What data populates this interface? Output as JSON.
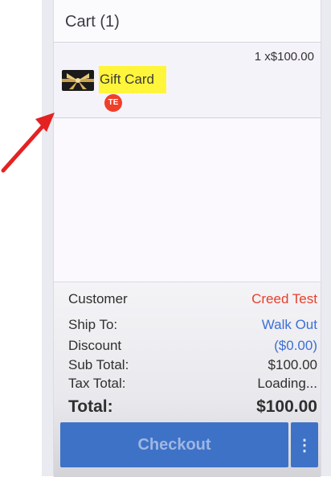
{
  "cart": {
    "title": "Cart (1)"
  },
  "item": {
    "quantity_price": "1 x$100.00",
    "name": "Gift Card",
    "badge": "TE",
    "thumbnail": "gift-card-thumbnail"
  },
  "summary": {
    "customer_label": "Customer",
    "customer_value": "Creed Test",
    "ship_label": "Ship To:",
    "ship_value": "Walk Out",
    "discount_label": "Discount",
    "discount_value": "($0.00)",
    "subtotal_label": "Sub Total:",
    "subtotal_value": "$100.00",
    "tax_label": "Tax Total:",
    "tax_value": "Loading...",
    "total_label": "Total:",
    "total_value": "$100.00"
  },
  "actions": {
    "checkout_label": "Checkout",
    "more_icon": "⋮"
  },
  "colors": {
    "accent": "#3e72c6",
    "customer_text": "#e6402c",
    "link_text": "#3d6fd6",
    "highlight": "#fff53a",
    "arrow": "#e32222"
  }
}
